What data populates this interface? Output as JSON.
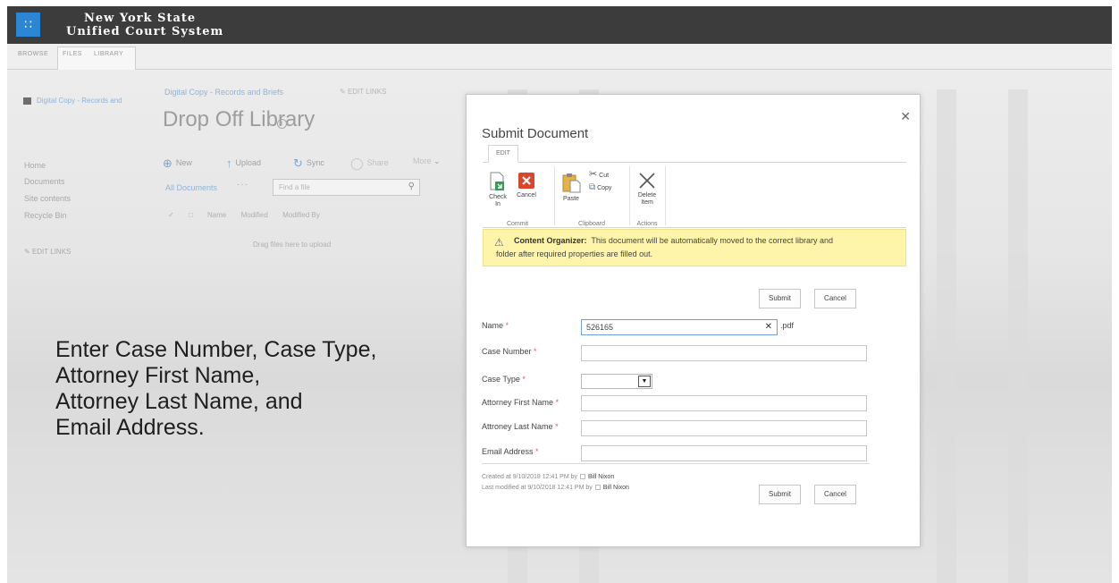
{
  "suite_bar": {
    "brand_line1": "New York State",
    "brand_line2": "Unified Court System"
  },
  "ribbon_tabs": [
    "BROWSE",
    "FILES",
    "LIBRARY"
  ],
  "site": {
    "logo_text": "Digital Copy - Records and",
    "breadcrumb": "Digital Copy - Records and Briefs",
    "edit_links": "EDIT LINKS",
    "page_title": "Drop Off Library"
  },
  "quick_launch": {
    "items": [
      "Home",
      "Documents",
      "Site contents",
      "Recycle Bin"
    ],
    "edit_links": "EDIT LINKS"
  },
  "commands": {
    "new": "New",
    "upload": "Upload",
    "sync": "Sync",
    "share": "Share",
    "more": "More"
  },
  "view": {
    "all_documents": "All Documents",
    "ellipsis": "···",
    "find_placeholder": "Find a file",
    "columns": [
      "Name",
      "Modified",
      "Modified By"
    ],
    "drag_text": "Drag files here to upload"
  },
  "instructions": {
    "line1": "Enter Case Number, Case Type,",
    "line2": "Attorney First Name,",
    "line3": "Attorney Last Name, and",
    "line4": "Email Address."
  },
  "dialog": {
    "title": "Submit Document",
    "ribbon": {
      "tab": "EDIT",
      "groups": {
        "commit": {
          "label": "Commit",
          "check_in_line1": "Check",
          "check_in_line2": "In",
          "cancel": "Cancel"
        },
        "clipboard": {
          "label": "Clipboard",
          "paste": "Paste",
          "cut": "Cut",
          "copy": "Copy"
        },
        "actions": {
          "label": "Actions",
          "delete_line1": "Delete",
          "delete_line2": "Item"
        }
      }
    },
    "notice": {
      "bold": "Content Organizer:",
      "text1": "This document will be automatically moved to the correct library and",
      "text2": "folder after required properties are filled out."
    },
    "submit_label": "Submit",
    "cancel_label": "Cancel",
    "fields": {
      "name_label": "Name",
      "name_value": "526165",
      "name_ext": ".pdf",
      "case_number_label": "Case Number",
      "case_number_value": "",
      "case_type_label": "Case Type",
      "case_type_value": "",
      "attorney_first_label": "Attorney First Name",
      "attorney_first_value": "",
      "attorney_last_label": "Attroney Last Name",
      "attorney_last_value": "",
      "email_label": "Email Address",
      "email_value": "",
      "required_marker": "*"
    },
    "meta": {
      "created_text": "Created at 9/10/2018 12:41 PM  by",
      "created_by": "Bill Nixon",
      "modified_text": "Last modified at 9/10/2018 12:41 PM  by",
      "modified_by": "Bill Nixon"
    }
  },
  "colors": {
    "suite_bar": "#3c3c3c",
    "waffle": "#2b86d6",
    "notice_bg": "#fff5aa",
    "link": "#8fb4d8"
  }
}
